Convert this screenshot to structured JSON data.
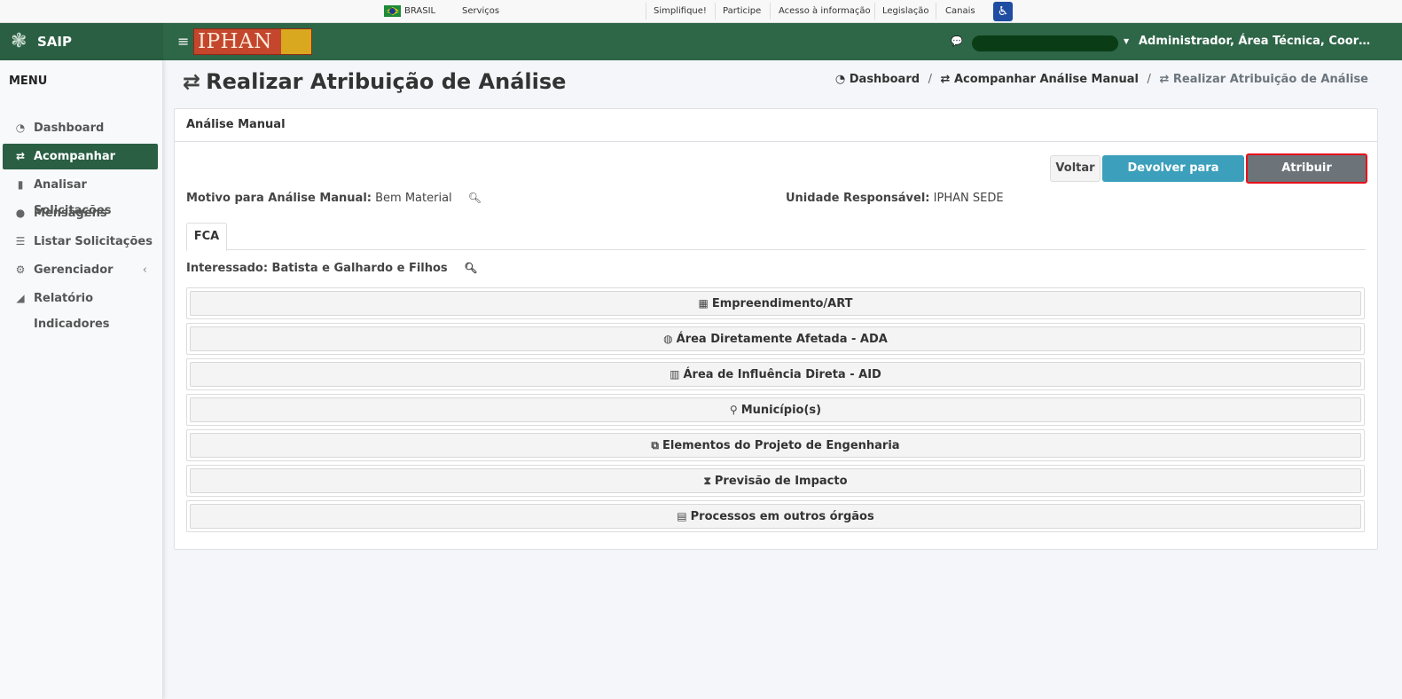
{
  "govbar": {
    "country": "BRASIL",
    "links": [
      "Serviços",
      "Simplifique!",
      "Participe",
      "Acesso à informação",
      "Legislação",
      "Canais"
    ]
  },
  "header": {
    "app_name": "SAIP",
    "logo_text": "IPHAN",
    "user": "Administrador, Área Técnica, Coordenação..."
  },
  "sidebar": {
    "title": "MENU",
    "items": [
      {
        "label": "Dashboard",
        "icon": "dashboard-icon"
      },
      {
        "label": "Acompanhar Análise",
        "icon": "exchange-icon",
        "active": true
      },
      {
        "label": "Analisar Solicitações",
        "icon": "book-icon"
      },
      {
        "label": "Mensagens",
        "icon": "comments-icon"
      },
      {
        "label": "Listar Solicitações",
        "icon": "list-icon"
      },
      {
        "label": "Gerenciador",
        "icon": "gears-icon",
        "has_submenu": true
      },
      {
        "label": "Relatório Indicadores",
        "icon": "area-chart-icon"
      }
    ]
  },
  "page": {
    "title": "Realizar Atribuição de Análise",
    "breadcrumb": [
      "Dashboard",
      "Acompanhar Análise Manual",
      "Realizar Atribuição de Análise"
    ]
  },
  "card": {
    "header": "Análise Manual",
    "buttons": {
      "voltar": "Voltar",
      "devolver": "Devolver para Correção",
      "atribuir": "Atribuir Solicitação"
    },
    "motivo_label": "Motivo para Análise Manual:",
    "motivo_value": "Bem Material",
    "unidade_label": "Unidade Responsável:",
    "unidade_value": "IPHAN SEDE",
    "tab": "FCA",
    "interessado": "Interessado: Batista e Galhardo e Filhos",
    "sections": [
      {
        "label": "Empreendimento/ART",
        "icon": "building-icon"
      },
      {
        "label": "Área Diretamente Afetada - ADA",
        "icon": "globe-icon"
      },
      {
        "label": "Área de Influência Direta - AID",
        "icon": "map-icon"
      },
      {
        "label": "Município(s)",
        "icon": "map-marker-icon"
      },
      {
        "label": "Elementos do Projeto de Engenharia",
        "icon": "cubes-icon"
      },
      {
        "label": "Previsão de Impacto",
        "icon": "hourglass-icon"
      },
      {
        "label": "Processos em outros órgãos",
        "icon": "archive-icon"
      }
    ]
  },
  "colors": {
    "header_green": "#2e6648",
    "active_green": "#2a5f43",
    "devolver_blue": "#3c9fbb",
    "atribuir_gray": "#6c7379",
    "highlight_red": "#e8101b"
  }
}
